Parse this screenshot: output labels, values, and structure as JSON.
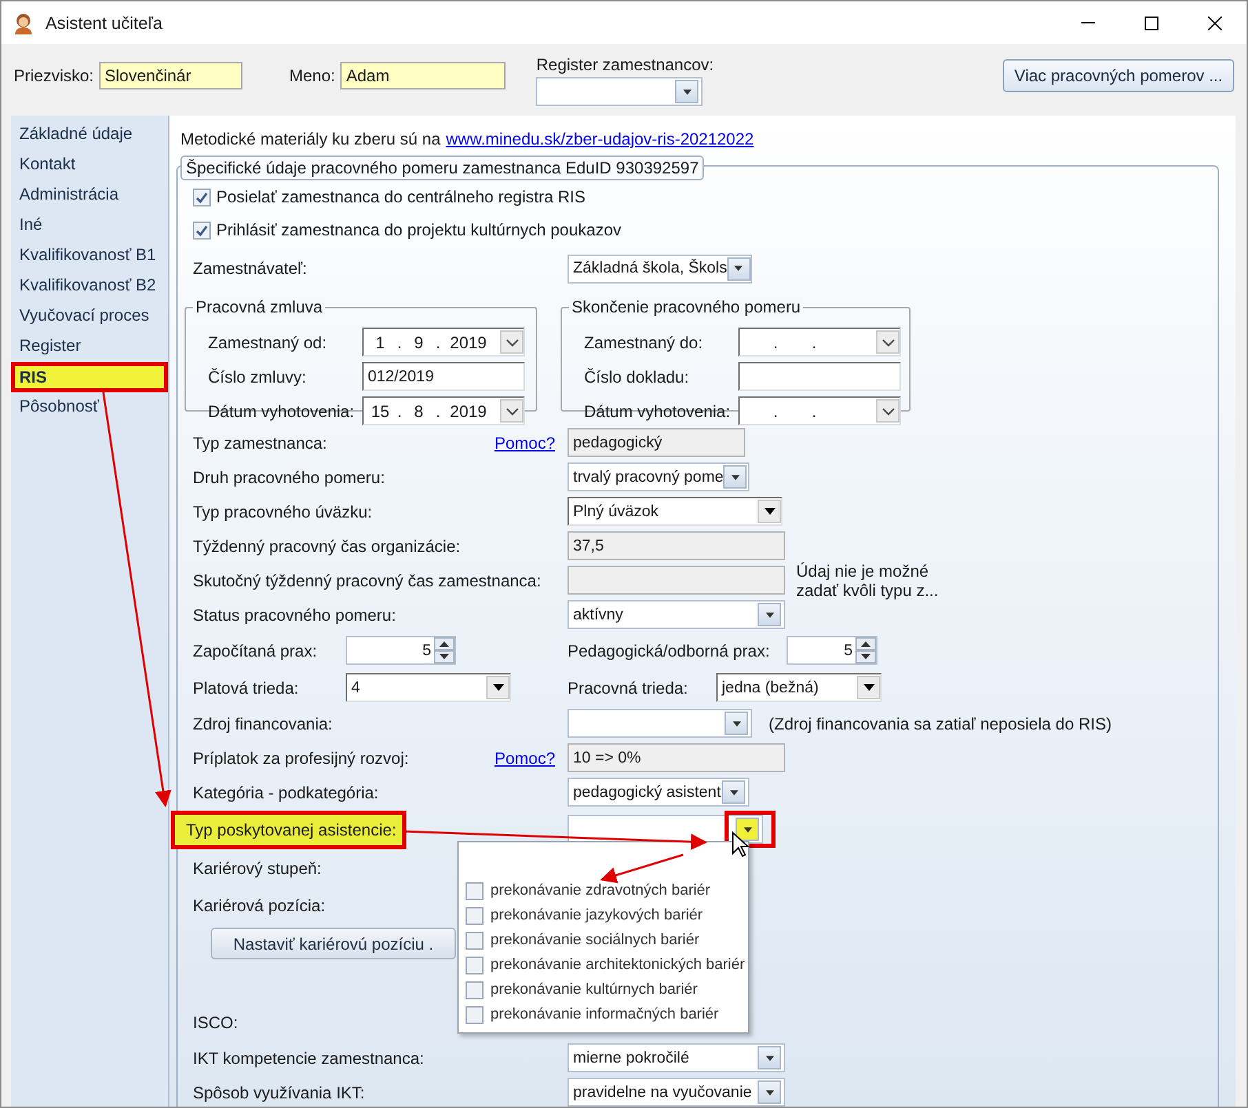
{
  "window": {
    "title": "Asistent učiteľa"
  },
  "header": {
    "surname_label": "Priezvisko:",
    "surname": "Slovenčinár",
    "name_label": "Meno:",
    "name": "Adam",
    "register_label": "Register zamestnancov:",
    "more_button": "Viac pracovných pomerov ..."
  },
  "sidebar": {
    "items": [
      {
        "label": "Základné údaje",
        "selected": false
      },
      {
        "label": "Kontakt",
        "selected": false
      },
      {
        "label": "Administrácia",
        "selected": false
      },
      {
        "label": "Iné",
        "selected": false
      },
      {
        "label": "Kvalifikovanosť B1",
        "selected": false
      },
      {
        "label": "Kvalifikovanosť B2",
        "selected": false
      },
      {
        "label": "Vyučovací proces",
        "selected": false
      },
      {
        "label": "Register",
        "selected": false
      },
      {
        "label": "RIS",
        "selected": true
      },
      {
        "label": "Pôsobnosť",
        "selected": false
      }
    ]
  },
  "info": {
    "text": "Metodické materiály ku zberu sú na",
    "link": "www.minedu.sk/zber-udajov-ris-20212022"
  },
  "group": {
    "title": "Špecifické údaje pracovného pomeru zamestnanca EduID 930392597"
  },
  "checkboxes": [
    {
      "label": "Posielať zamestnanca do centrálneho registra RIS",
      "checked": true
    },
    {
      "label": "Prihlásiť zamestnanca do projektu kultúrnych poukazov",
      "checked": true
    }
  ],
  "employer": {
    "label": "Zamestnávateľ:",
    "value": "Základná škola, Škols"
  },
  "subgroups": [
    {
      "title": "Pracovná zmluva",
      "fields": [
        {
          "kind": "date",
          "label": "Zamestnaný od:",
          "segments": [
            "1",
            ".",
            "9",
            ".",
            "2019"
          ]
        },
        {
          "kind": "text",
          "label": "Číslo zmluvy:",
          "value": "012/2019"
        },
        {
          "kind": "date",
          "label": "Dátum vyhotovenia:",
          "segments": [
            "15",
            ".",
            "8",
            ".",
            "2019"
          ]
        }
      ]
    },
    {
      "title": "Skončenie pracovného pomeru",
      "fields": [
        {
          "kind": "date",
          "label": "Zamestnaný do:",
          "segments": [
            ".",
            "."
          ]
        },
        {
          "kind": "text",
          "label": "Číslo dokladu:"
        },
        {
          "kind": "date",
          "label": "Dátum vyhotovenia:",
          "segments": [
            ".",
            "."
          ]
        }
      ]
    }
  ],
  "fields": [
    {
      "kind": "readonly",
      "label": "Typ zamestnanca:",
      "help": "Pomoc?",
      "value": "pedagogický"
    },
    {
      "kind": "combo",
      "label": "Druh pracovného pomeru:",
      "value": "trvalý pracovný pome"
    },
    {
      "kind": "dropdown",
      "label": "Typ pracovného úväzku:",
      "value": "Plný úväzok"
    },
    {
      "kind": "readonly",
      "label": "Týždenný pracovný čas organizácie:",
      "value": "37,5"
    },
    {
      "kind": "readonly",
      "label": "Skutočný týždenný pracovný čas zamestnanca:",
      "note": "Údaj nie je možné zadať kvôli typu z..."
    },
    {
      "kind": "combo",
      "label": "Status pracovného pomeru:",
      "value": "aktívny"
    },
    {
      "kind": "pair",
      "items": [
        {
          "kind": "spin",
          "label": "Započítaná prax:",
          "value": "5"
        },
        {
          "kind": "spin",
          "label": "Pedagogická/odborná prax:",
          "value": "5"
        }
      ]
    },
    {
      "kind": "pair",
      "items": [
        {
          "kind": "dropdown",
          "label": "Platová trieda:",
          "value": "4"
        },
        {
          "kind": "dropdown",
          "label": "Pracovná trieda:",
          "value": "jedna (bežná)"
        }
      ]
    },
    {
      "kind": "combo",
      "label": "Zdroj financovania:",
      "note": "(Zdroj financovania sa zatiaľ neposiela do RIS)"
    },
    {
      "kind": "readonly",
      "label": "Príplatok za profesijný rozvoj:",
      "help": "Pomoc?",
      "value": "10 => 0%"
    },
    {
      "kind": "combo",
      "label": "Kategória - podkategória:",
      "value": "pedagogický asistent"
    },
    {
      "kind": "combo",
      "label": "Typ poskytovanej asistencie:",
      "highlighted": true,
      "options": [
        {
          "label": "prekonávanie zdravotných bariér",
          "checked": false
        },
        {
          "label": "prekonávanie jazykových bariér",
          "checked": false
        },
        {
          "label": "prekonávanie sociálnych bariér",
          "checked": false
        },
        {
          "label": "prekonávanie architektonických bariér",
          "checked": false
        },
        {
          "label": "prekonávanie kultúrnych bariér",
          "checked": false
        },
        {
          "label": "prekonávanie informačných bariér",
          "checked": false
        }
      ]
    },
    {
      "kind": "empty",
      "label": "Kariérový stupeň:"
    },
    {
      "kind": "empty",
      "label": "Kariérová pozícia:"
    },
    {
      "kind": "button",
      "label": "Nastaviť kariérovú pozíciu ."
    },
    {
      "kind": "empty",
      "label": "ISCO:"
    },
    {
      "kind": "combo",
      "label": "IKT kompetencie zamestnanca:",
      "value": "mierne pokročilé"
    },
    {
      "kind": "combo",
      "label": "Spôsob využívania IKT:",
      "value": "pravidelne na vyučovanie"
    }
  ]
}
